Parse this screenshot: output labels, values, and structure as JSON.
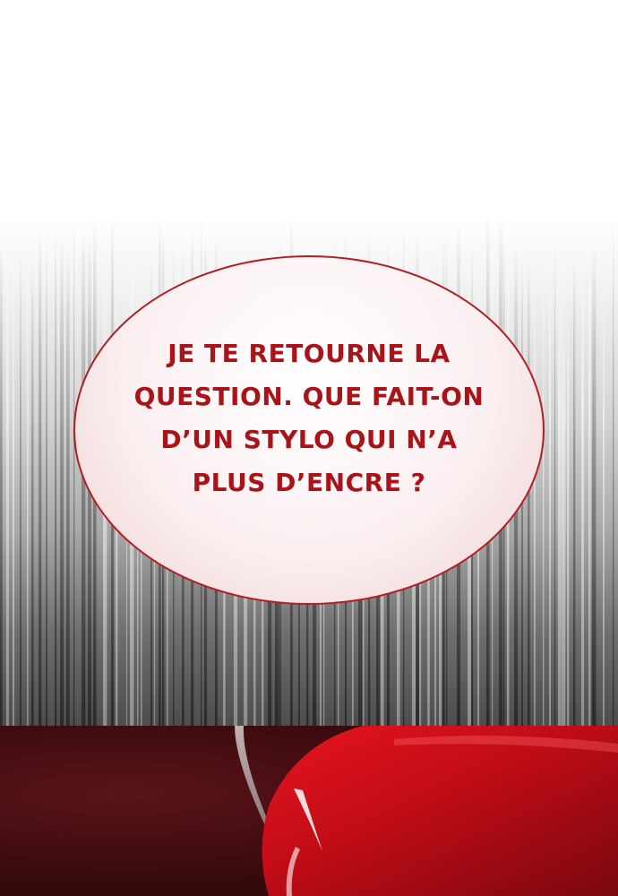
{
  "speech_bubble": {
    "lines": [
      "JE TE RETOURNE LA",
      "QUESTION. QUE FAIT-ON",
      "D’UN STYLO QUI N’A",
      "PLUS D’ENCRE ?"
    ]
  },
  "colors": {
    "text_red": "#a8141a",
    "bubble_border": "#b01e22",
    "panel_dark_red": "#3a0b0e",
    "object_red": "#c8101a"
  }
}
